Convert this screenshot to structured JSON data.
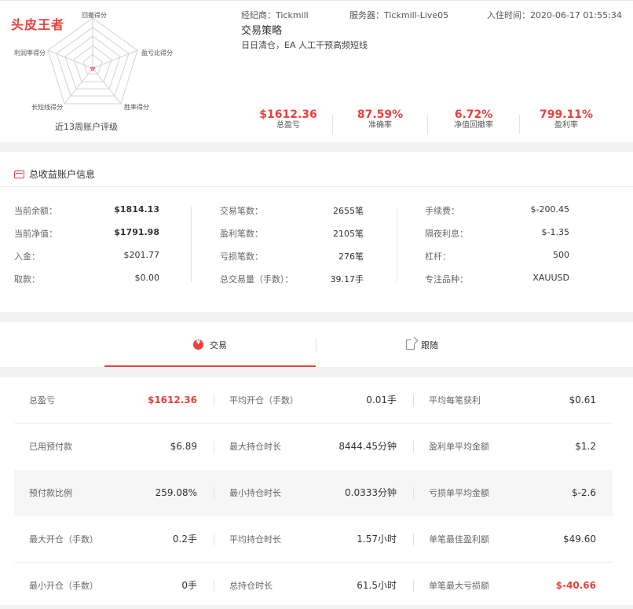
{
  "brand": {
    "logo_text": "头皮王者"
  },
  "radar": {
    "axes": [
      "回撤得分",
      "盈亏比得分",
      "胜率得分",
      "长短线得分",
      "利润率得分"
    ],
    "caption": "近13周账户评级"
  },
  "account": {
    "broker": "经纪商：Tickmill",
    "server": "服务器：Tickmill-Live05",
    "join_time": "入住时间：2020-06-17 01:55:34",
    "strategy_title": "交易策略",
    "strategy_desc": "日日清仓，EA 人工干预高频短线"
  },
  "kpis": [
    {
      "value": "$1612.36",
      "label": "总盈亏"
    },
    {
      "value": "87.59%",
      "label": "准确率"
    },
    {
      "value": "6.72%",
      "label": "净值回撤率"
    },
    {
      "value": "799.11%",
      "label": "盈利率"
    }
  ],
  "info": {
    "title": "总收益账户信息",
    "col1": [
      {
        "label": "当前余额：",
        "value": "$1814.13",
        "red": true
      },
      {
        "label": "当前净值：",
        "value": "$1791.98",
        "red": true
      },
      {
        "label": "入金：",
        "value": "$201.77"
      },
      {
        "label": "取款：",
        "value": "$0.00"
      }
    ],
    "col2": [
      {
        "label": "交易笔数：",
        "value": "2655笔"
      },
      {
        "label": "盈利笔数：",
        "value": "2105笔"
      },
      {
        "label": "亏损笔数：",
        "value": "276笔"
      },
      {
        "label": "总交易量（手数）：",
        "value": "39.17手"
      }
    ],
    "col3": [
      {
        "label": "手续费：",
        "value": "$-200.45"
      },
      {
        "label": "隔夜利息：",
        "value": "$-1.35"
      },
      {
        "label": "杠杆：",
        "value": "500"
      },
      {
        "label": "专注品种：",
        "value": "XAUUSD"
      }
    ]
  },
  "tabs": {
    "trade": "交易",
    "follow": "跟随"
  },
  "stats": [
    [
      {
        "label": "总盈亏",
        "value": "$1612.36",
        "red": true
      },
      {
        "label": "平均开仓（手数）",
        "value": "0.01手"
      },
      {
        "label": "平均每笔获利",
        "value": "$0.61"
      }
    ],
    [
      {
        "label": "已用预付款",
        "value": "$6.89"
      },
      {
        "label": "最大持仓时长",
        "value": "8444.45分钟"
      },
      {
        "label": "盈利单平均金额",
        "value": "$1.2"
      }
    ],
    [
      {
        "label": "预付款比例",
        "value": "259.08%"
      },
      {
        "label": "最小持仓时长",
        "value": "0.0333分钟"
      },
      {
        "label": "亏损单平均金额",
        "value": "$-2.6"
      }
    ],
    [
      {
        "label": "最大开仓（手数）",
        "value": "0.2手"
      },
      {
        "label": "平均持仓时长",
        "value": "1.57小时"
      },
      {
        "label": "单笔最佳盈利额",
        "value": "$49.60"
      }
    ],
    [
      {
        "label": "最小开仓（手数）",
        "value": "0手"
      },
      {
        "label": "总持仓时长",
        "value": "61.5小时"
      },
      {
        "label": "单笔最大亏损额",
        "value": "$-40.66",
        "red": true
      }
    ]
  ]
}
